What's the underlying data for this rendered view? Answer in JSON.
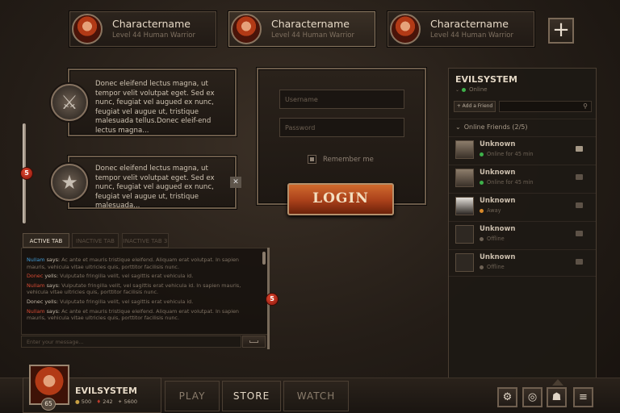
{
  "characters": [
    {
      "name": "Charactername",
      "level": "Level 44",
      "race": "Human",
      "cls": "Warrior"
    },
    {
      "name": "Charactername",
      "level": "Level 44",
      "race": "Human",
      "cls": "Warrior"
    },
    {
      "name": "Charactername",
      "level": "Level 44",
      "race": "Human",
      "cls": "Warrior"
    }
  ],
  "plus_label": "+",
  "info1": "Donec eleifend lectus magna, ut tempor velit volutpat eget. Sed ex nunc, feugiat vel augued ex nunc, feugiat vel augue ut, tristique malesuada tellus.Donec eleif-end lectus magna...",
  "info2": "Donec eleifend lectus magna, ut tempor velit volutpat eget. Sed ex nunc, feugiat vel augued ex nunc, feugiat vel augue ut, tristique malesuada...",
  "close_label": "✕",
  "slider_badge": "5",
  "chat_badge": "5",
  "login": {
    "username_placeholder": "Username",
    "password_placeholder": "Password",
    "remember": "Remember me",
    "button": "LOGIN"
  },
  "tabs": [
    "ACTIVE TAB",
    "INACTIVE TAB",
    "INACTIVE TAB 3"
  ],
  "chat": [
    {
      "who": "Nullam",
      "verb": "says:",
      "text": "Ac ante et mauris tristique eleifend. Aliquam erat volutpat. In sapien mauris, vehicula vitae ultricies quis, porttitor facilisis nunc.",
      "color": "#3f9bd6"
    },
    {
      "who": "Donec",
      "verb": "yells:",
      "text": "Vulputate fringilla velit, vel sagittis erat vehicula id.",
      "color": "#d64a33"
    },
    {
      "who": "Nullam",
      "verb": "says:",
      "text": "Vulputate fringilla velit, vel sagittis erat vehicula id. In sapien mauris, vehicula vitae ultricies quis, porttitor facilisis nunc.",
      "color": "#d64a33"
    },
    {
      "who": "Donec",
      "verb": "yells:",
      "text": "Vulputate fringilla velit, vel sagittis erat vehicula id.",
      "color": "#c4b8a7"
    },
    {
      "who": "Nullam",
      "verb": "says:",
      "text": "Ac ante et mauris tristique eleifend. Aliquam erat volutpat. In sapien mauris, vehicula vitae ultricies quis, porttitor facilisis nunc.",
      "color": "#d64a33"
    }
  ],
  "chat_input_placeholder": "Enter your message...",
  "friends": {
    "title": "EVILSYSTEM",
    "status": "Online",
    "add_friend": "+ Add a Friend",
    "group": "Online Friends",
    "count": "(2/5)",
    "list": [
      {
        "name": "Unknown",
        "status": "Online for 45 min",
        "dot": "#3eb04a"
      },
      {
        "name": "Unknown",
        "status": "Online for 45 min",
        "dot": "#3eb04a"
      },
      {
        "name": "Unknown",
        "status": "Away",
        "dot": "#d98a2a"
      },
      {
        "name": "Unknown",
        "status": "Offline",
        "dot": "#6e6255"
      },
      {
        "name": "Unknown",
        "status": "Offline",
        "dot": "#6e6255"
      }
    ]
  },
  "player": {
    "name": "EVILSYSTEM",
    "level": "65",
    "gold": "500",
    "rubies": "242",
    "points": "5600"
  },
  "nav": [
    "PLAY",
    "STORE",
    "WATCH"
  ],
  "icons": {
    "settings": "⚙",
    "globe": "◎",
    "friends": "☗",
    "menu": "≡"
  }
}
